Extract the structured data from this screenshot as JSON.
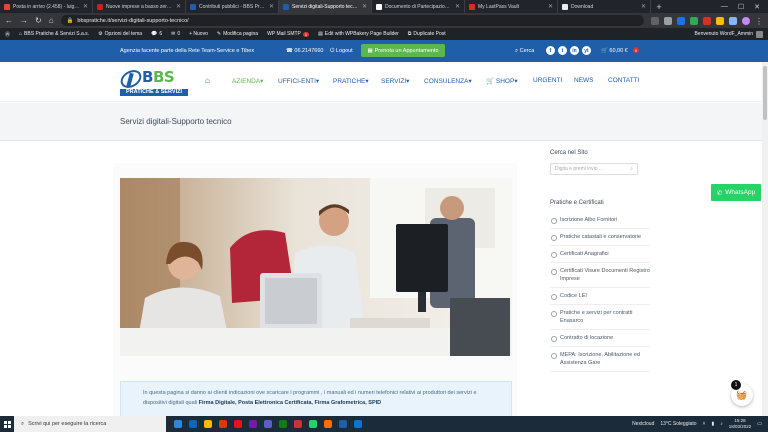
{
  "browser": {
    "tabs": [
      {
        "title": "Posta in arrivo (2.458) - luigi.b...",
        "color": "#ea4335",
        "active": false
      },
      {
        "title": "Nuove imprese a basso zero oppr...",
        "color": "#c5221f",
        "active": false
      },
      {
        "title": "Contributi pubblici - BBS Pratich...",
        "color": "#1f5ea8",
        "active": false
      },
      {
        "title": "Servizi digitali-Supporto tecnico",
        "color": "#1f5ea8",
        "active": true
      },
      {
        "title": "Documento di Partecipazione o...",
        "color": "#ffffff",
        "active": false
      },
      {
        "title": "My LastPass Vault",
        "color": "#d32d27",
        "active": false
      },
      {
        "title": "Download",
        "color": "#e8eaed",
        "active": false
      }
    ],
    "new_tab": "+",
    "url": "bbspratiche.it/servizi-digitali-supporto-tecnico/"
  },
  "wp_admin_bar": {
    "site": "BBS Pratiche & Servizi S.a.s.",
    "theme_options": "Opzioni del tema",
    "comments": "6",
    "updates": "0",
    "new": "+ Nuovo",
    "edit_page": "Modifica pagina",
    "smtp": "WP Mail SMTP",
    "smtp_badge": "1",
    "wpbakery": "Edit with WPBakery Page Builder",
    "duplicate": "Duplicate Post",
    "greeting": "Benvenuto WordF_Ammin"
  },
  "topbar": {
    "agency": "Agenzia facente parte della Rete Team-Service e Tibex",
    "phone": "06.2147660",
    "logout": "Logout",
    "appointment": "Prenota un Appuntamento",
    "search": "Cerca",
    "social": [
      "f",
      "t",
      "in",
      "yt"
    ],
    "cart": "60,00 €",
    "cart_count": "0"
  },
  "logo": {
    "brand_a": "B",
    "brand_b": "BS",
    "sub": "PRATICHE & SERVIZI"
  },
  "nav": [
    {
      "label": "AZIENDA",
      "caret": "▾",
      "active": true
    },
    {
      "label": "UFFICI-ENTI",
      "caret": "▾",
      "active": false
    },
    {
      "label": "PRATICHE",
      "caret": "▾",
      "active": false
    },
    {
      "label": "SERVIZI",
      "caret": "▾",
      "active": false
    },
    {
      "label": "CONSULENZA",
      "caret": "▾",
      "active": false
    },
    {
      "label": "SHOP",
      "caret": "▾",
      "active": false
    },
    {
      "label": "URGENTI",
      "caret": "",
      "active": false
    },
    {
      "label": "NEWS",
      "caret": "",
      "active": false
    },
    {
      "label": "CONTATTI",
      "caret": "",
      "active": false
    }
  ],
  "page": {
    "title": "Servizi digitali-Supporto tecnico",
    "intro_part1": "In questa pagina si danno ai clienti indicazioni ove scaricare i programmi , i manuali ed i numeri telefonici relativi ai",
    "intro_part2": "produttori dei servizi e dispositivi digitali quali ",
    "intro_bold": "Firma Digitale, Posta Elettronica Certificata, Firma Grafometrica, SPID"
  },
  "sidebar": {
    "search_heading": "Cerca nel Sito",
    "search_placeholder": "Digita e premi invio ...",
    "list_heading": "Pratiche e Certificati",
    "items": [
      "Iscrizione Albo Fornitori",
      "Pratiche catastali e conservatorie",
      "Certificati Anagrafici",
      "Certificati Visure Documenti Registro Imprese",
      "Codice LEI",
      "Pratiche e servizi per contratti Enasarco",
      "Contratto di locazione",
      "MEPA: Iscrizione, Abilitazione ed Assistenza Gare"
    ]
  },
  "floating": {
    "whatsapp": "WhatsApp",
    "cart_count": "1"
  },
  "taskbar": {
    "search_placeholder": "Scrivi qui per eseguire la ricerca",
    "app_colors": [
      "#2b88d9",
      "#0a68b7",
      "#ffb900",
      "#d83b01",
      "#e81123",
      "#7719aa",
      "#5b5fc7",
      "#107c10",
      "#cc3333",
      "#25d366",
      "#ff6a00",
      "#1f5ea8",
      "#0078d4"
    ],
    "nextcloud": "Nextcloud",
    "weather": "13°C Soleggiato",
    "time": "15:28",
    "date": "18/03/2022"
  }
}
